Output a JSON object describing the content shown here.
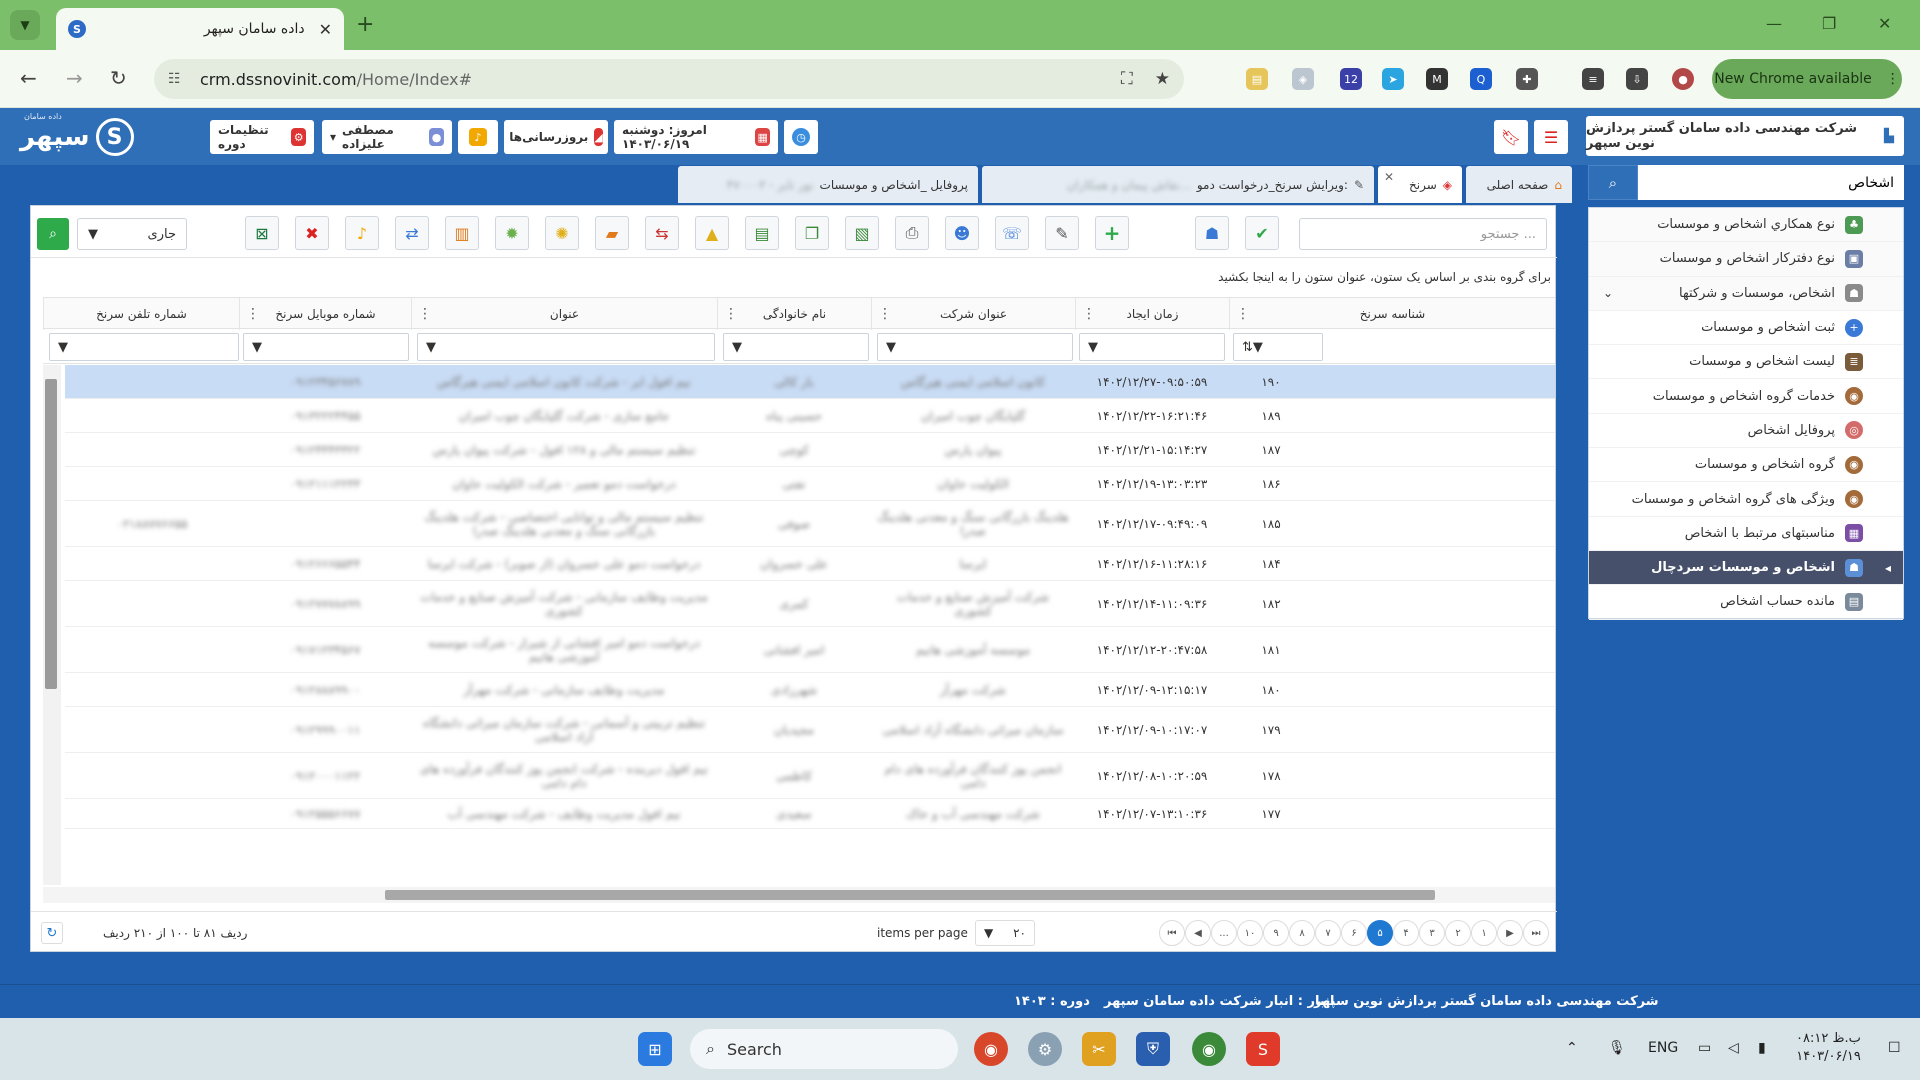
{
  "browser": {
    "tab_title": "داده سامان سپهر",
    "url_host": "crm.dssnovinit.com",
    "url_path": "/Home/Index#",
    "new_chrome": "New Chrome available",
    "ext_badge": "12"
  },
  "header": {
    "logo_text": "سپهر",
    "logo_small": "داده سامان",
    "period_settings": "تنظیمات دوره",
    "user_name": "مصطفی علیزاده",
    "updates": "بروزرسانی‌ها",
    "today": "امروز: دوشنبه ۱۴۰۳/۰۶/۱۹",
    "company": "شرکت مهندسی داده سامان گستر پردازش نوین سپهر"
  },
  "sidebar": {
    "search_value": "اشخاص",
    "items": [
      {
        "label": "نوع همکاري اشخاص و موسسات"
      },
      {
        "label": "نوع دفترکار اشخاص و موسسات"
      },
      {
        "label": "اشخاص، موسسات و شرکتها"
      },
      {
        "label": "ثبت اشخاص و موسسات"
      },
      {
        "label": "لیست اشخاص و موسسات"
      },
      {
        "label": "خدمات گروه اشخاص و موسسات"
      },
      {
        "label": "پروفایل اشخاص"
      },
      {
        "label": "گروه اشخاص و موسسات"
      },
      {
        "label": "ویژگی های گروه اشخاص و موسسات"
      },
      {
        "label": "مناسبتهای مرتبط با اشخاص"
      },
      {
        "label": "اشخاص و موسسات سردچال"
      },
      {
        "label": "مانده حساب اشخاص"
      }
    ]
  },
  "tabs": {
    "home": "صفحه اصلی",
    "lead": "سرنخ",
    "edit": "ویرایش سرنخ_درخواست دمو:",
    "edit_blur": "نقاش پیمان و همکاران...",
    "profile": "پروفایل _اشخاص و موسسات",
    "profile_blur": "۴۷۰۰۰۳ - نور تایر"
  },
  "toolbar": {
    "search_placeholder": "جستجو ...",
    "status": "جاری"
  },
  "grid": {
    "group_hint": "برای گروه بندی بر اساس یک ستون، عنوان ستون را به اینجا بکشید",
    "headers": {
      "id": "شناسه سرنخ",
      "created": "زمان ایجاد",
      "company": "عنوان شرکت",
      "family": "نام خانوادگی",
      "title": "عنوان",
      "mobile": "شماره موبایل سرنخ",
      "phone": "شماره تلفن سرنخ"
    },
    "rows": [
      {
        "id": "۱۹۰",
        "created": "۱۴۰۲/۱۲/۲۷-۰۹:۵۰:۵۹",
        "company": "کانون اسلامی ایمنی هیرگاس",
        "family": "بار کالی",
        "title": "نیم افول ایر - شرکت کانون اسلامی ایمنی هیرگاس",
        "mobile": "۰۹۱۲۳۴۵۶۷۸۹",
        "phone": ""
      },
      {
        "id": "۱۸۹",
        "created": "۱۴۰۲/۱۲/۲۲-۱۶:۲۱:۴۶",
        "company": "گلپایگان چوب امیران",
        "family": "حسینی پناه",
        "title": "جامع سازی - شرکت گلپایگان چوب امیران",
        "mobile": "۰۹۱۳۲۲۲۴۴۵۵",
        "phone": ""
      },
      {
        "id": "۱۸۷",
        "created": "۱۴۰۲/۱۲/۲۱-۱۵:۱۴:۲۷",
        "company": "پیوان پارس",
        "family": "کوچی",
        "title": "تنظیم سیستم مالی و ۱۲۸ افول - شرکت پیوان پارس",
        "mobile": "۰۹۱۲۴۴۴۳۳۲۲",
        "phone": ""
      },
      {
        "id": "۱۸۶",
        "created": "۱۴۰۲/۱۲/۱۹-۱۳:۰۳:۲۳",
        "company": "الکولیت خاوان",
        "family": "تفتی",
        "title": "درخواست دمو تعمیر - شرکت الکولیت خاوان",
        "mobile": "۰۹۱۲۱۱۱۲۲۳۳",
        "phone": ""
      },
      {
        "id": "۱۸۵",
        "created": "۱۴۰۲/۱۲/۱۷-۰۹:۴۹:۰۹",
        "company": "هلدینگ بازرگانی سنگ و معدنی هلدینگ صدرا",
        "family": "صوفی",
        "title": "تنظیم سیستم مالی و توانایی اختصاصی - شرکت هلدینگ بازرگانی سنگ و معدنی هلدینگ صدرا",
        "mobile": "",
        "phone": "۰۲۱۸۸۷۷۶۶۵۵"
      },
      {
        "id": "۱۸۴",
        "created": "۱۴۰۲/۱۲/۱۶-۱۱:۲۸:۱۶",
        "company": "ایرسا",
        "family": "علی خسروان",
        "title": "درخواست دمو علی خسروان (ار صوبر) - شرکت ایرسا",
        "mobile": "۰۹۱۲۶۶۶۵۵۴۴",
        "phone": ""
      },
      {
        "id": "۱۸۲",
        "created": "۱۴۰۲/۱۲/۱۴-۱۱:۰۹:۳۶",
        "company": "شرکت آمیزش صنایع و خدمات کشوری",
        "family": "کمری",
        "title": "مدیریت وظایف سازمانی - شرکت آمیزش صنایع و خدمات کشوری",
        "mobile": "۰۹۱۲۷۷۷۸۸۹۹",
        "phone": ""
      },
      {
        "id": "۱۸۱",
        "created": "۱۴۰۲/۱۲/۱۲-۲۰:۴۷:۵۸",
        "company": "موسسه آموزشی هانیم",
        "family": "امیر افشانی",
        "title": "درخواست دمو امیر افشانی از شیراز - شرکت موسسه آموزشی هانیم",
        "mobile": "۰۹۱۷۱۲۳۴۵۶۷",
        "phone": ""
      },
      {
        "id": "۱۸۰",
        "created": "۱۴۰۲/۱۲/۰۹-۱۲:۱۵:۱۷",
        "company": "شرکت مهرآز",
        "family": "شهرزادی",
        "title": "مدیریت وظایف سازمانی - شرکت مهرآز",
        "mobile": "۰۹۱۲۸۸۸۹۹۰۰",
        "phone": ""
      },
      {
        "id": "۱۷۹",
        "created": "۱۴۰۲/۱۲/۰۹-۱۰:۱۷:۰۷",
        "company": "سازمان میراثی دانشگاه آزاد اسلامی",
        "family": "مجیدیان",
        "title": "تنظیم تربیتی و آسمانی - شرکت سازمان میراثی دانشگاه آزاد اسلامی",
        "mobile": "۰۹۱۲۹۹۹۰۰۱۱",
        "phone": ""
      },
      {
        "id": "۱۷۸",
        "created": "۱۴۰۲/۱۲/۰۸-۱۰:۲۰:۵۹",
        "company": "انجمن پوز کنندگان فرآورده های دام دامی",
        "family": "کاظمی",
        "title": "نیم افول دیربنده - شرکت انجمن پوز کنندگان فرآورده های دام دامی",
        "mobile": "۰۹۱۲۰۰۰۱۱۲۲",
        "phone": ""
      },
      {
        "id": "۱۷۷",
        "created": "۱۴۰۲/۱۲/۰۷-۱۳:۱۰:۳۶",
        "company": "شرکت مهندسی آب و خاک",
        "family": "سعیدی",
        "title": "نیم افول مدیریت وظایف - شرکت مهندسی آب",
        "mobile": "۰۹۱۲۵۵۵۶۶۷۷",
        "phone": ""
      }
    ]
  },
  "pager": {
    "pages": [
      "۱",
      "۲",
      "۳",
      "۴",
      "۵",
      "۶",
      "۷",
      "۸",
      "۹",
      "۱۰",
      "..."
    ],
    "current": "۵",
    "page_size": "۲۰",
    "items_per_page": "items per page",
    "row_info": "ردیف ۸۱ تا ۱۰۰ از ۲۱۰ ردیف"
  },
  "footer": {
    "company": "شرکت مهندسی داده سامان گستر پردازش نوین سپهر",
    "warehouse": "انبار : انبار شرکت داده سامان سپهر",
    "period": "دوره : ۱۴۰۳"
  },
  "taskbar": {
    "search": "Search",
    "lang": "ENG",
    "time": "۰۸:۱۲ ب.ظ",
    "date": "۱۴۰۳/۰۶/۱۹"
  },
  "colors": {
    "brand_blue": "#2f6fb8",
    "chrome_green": "#7bbf6a",
    "selected_row": "#c9dcf5",
    "active_sidebar": "#46506b",
    "pager_current": "#1f79d1"
  }
}
